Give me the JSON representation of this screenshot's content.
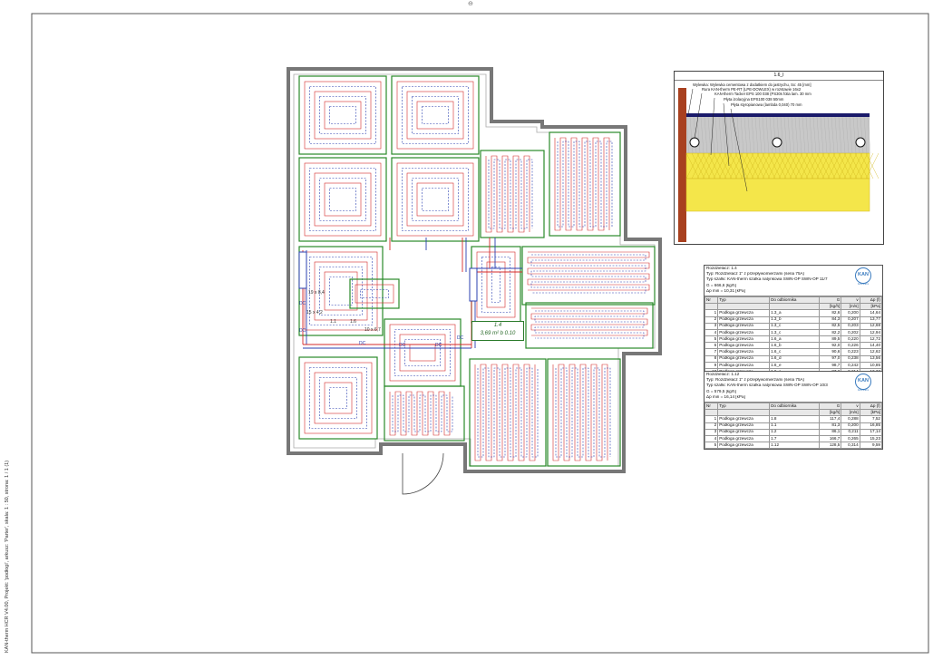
{
  "sheet": {
    "side_caption": "KAN-therm HCR V4.00, Projekt: 'podłogi', arkusz: 'Parter', skala: 1 : 50, strona: 1 / 1 (1)",
    "top_mark": "⊖"
  },
  "section": {
    "title": "1.6_I",
    "layers": [
      "Wylewka: Wylewka cementowa z dodatkiem do jastrychu, Sx: 45 [mm]",
      "Rura KAN-therm PE-RT (LPE-DOWLEX) w rozstawie 16x2",
      "KAN-therm Tacker EPS 100 038 (PS30s folia lam. 30 mm",
      "Płyta izolacyjna EPS100 038 50mm",
      "Płyta styropianowa (lambda 0,040) 70 mm"
    ]
  },
  "zone_label": {
    "name": "1.4",
    "value": "3,69 m²  b 0.10"
  },
  "manifold_marks": [
    "DC",
    "DC",
    "DC",
    "DC",
    "DC",
    "DC"
  ],
  "manifold_notes": [
    "19 x 8,4",
    "15 x 4,2",
    "10 x 6,7",
    "1.6",
    "1.1"
  ],
  "logo": {
    "text": "KAN",
    "sub": "KAN-therm"
  },
  "table1": {
    "header": [
      "Rozdzielacz: 1.4",
      "Typ: Rozdzielacz 1\" z przepływomierzami (seria 75A)",
      "Typ szafki: KAN-therm szafka natynkowa SWN-OP SWN-OP 11/7",
      "G = 666,6 [kg/h]",
      "Δp min = 10,31 [kPa]"
    ],
    "columns": [
      "Nr",
      "Typ",
      "Do odbiornika",
      "G",
      "v",
      "Δp (f)"
    ],
    "units": [
      "",
      "",
      "",
      "[kg/h]",
      "[m/s]",
      "[kPa]"
    ],
    "rows": [
      [
        "1",
        "Podłoga grzewcza",
        "1.3_a",
        "82,6",
        "0,200",
        "14,64"
      ],
      [
        "2",
        "Podłoga grzewcza",
        "1.3_b",
        "84,3",
        "0,207",
        "13,77"
      ],
      [
        "3",
        "Podłoga grzewcza",
        "1.3_c",
        "82,5",
        "0,203",
        "12,68"
      ],
      [
        "4",
        "Podłoga grzewcza",
        "1.3_c",
        "82,2",
        "0,202",
        "12,94"
      ],
      [
        "5",
        "Podłoga grzewcza",
        "1.6_a",
        "89,5",
        "0,220",
        "12,72"
      ],
      [
        "6",
        "Podłoga grzewcza",
        "1.6_b",
        "92,0",
        "0,226",
        "14,40"
      ],
      [
        "7",
        "Podłoga grzewcza",
        "1.6_c",
        "90,6",
        "0,223",
        "12,62"
      ],
      [
        "8",
        "Podłoga grzewcza",
        "1.6_d",
        "97,0",
        "0,238",
        "13,56"
      ],
      [
        "9",
        "Podłoga grzewcza",
        "1.6_e",
        "98,7",
        "0,242",
        "10,85"
      ],
      [
        "10",
        "Podłoga grzewcza",
        "1.6_c",
        "87,2",
        "0,214",
        "13,33"
      ]
    ]
  },
  "table2": {
    "header": [
      "Rozdzielacz: 1.12",
      "Typ: Rozdzielacz 1\" z przepływomierzami (seria 75A)",
      "Typ szafki: KAN-therm szafka natynkowa SWN-OP SWN-OP 10/3",
      "G = 579,5 [kg/h]",
      "Δp min = 16,14 [kPa]"
    ],
    "columns": [
      "Nr",
      "Typ",
      "Do odbiornika",
      "G",
      "v",
      "Δp (f)"
    ],
    "units": [
      "",
      "",
      "",
      "[kg/h]",
      "[m/s]",
      "[kPa]"
    ],
    "rows": [
      [
        "1",
        "Podłoga grzewcza",
        "1.8",
        "117,4",
        "0,288",
        "7,52"
      ],
      [
        "2",
        "Podłoga grzewcza",
        "1.1",
        "81,3",
        "0,200",
        "16,85"
      ],
      [
        "3",
        "Podłoga grzewcza",
        "1.2",
        "86,1",
        "0,211",
        "17,14"
      ],
      [
        "4",
        "Podłoga grzewcza",
        "1.7",
        "166,7",
        "0,265",
        "15,23"
      ],
      [
        "5",
        "Podłoga grzewcza",
        "1.12",
        "128,5",
        "0,314",
        "9,59"
      ]
    ]
  },
  "colors": {
    "supply": "#d42a2a",
    "return": "#2a3fb0",
    "zone": "#2a8a2a",
    "wall": "#777777",
    "insulation": "#f4e64a",
    "screed": "#9a9a9a",
    "brick": "#a8401f",
    "floor": "#1a1a6a"
  }
}
